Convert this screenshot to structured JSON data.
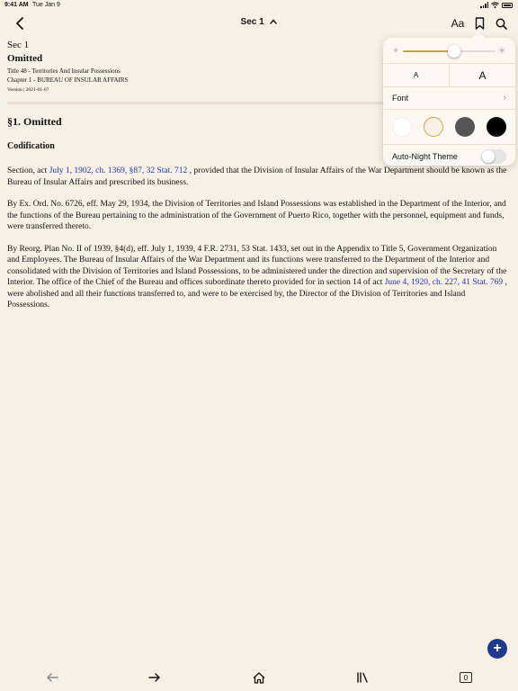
{
  "status": {
    "time": "9:41 AM",
    "date": "Tue Jan 9"
  },
  "nav": {
    "title": "Sec 1",
    "font_button_label": "Aa"
  },
  "doc": {
    "section_label": "Sec 1",
    "status_heading": "Omitted",
    "title_line": "Title 48 - Territories And Insular Possessions",
    "chapter_line": "Chapter 1 - BUREAU OF INSULAR AFFAIRS",
    "version_line": "Version | 2021-01-07",
    "heading": "§1. Omitted",
    "subheading": "Codification",
    "p1": {
      "before": "Section, act ",
      "link": "July 1, 1902, ch. 1369, §87, 32 Stat. 712",
      "after": " , provided that the Division of Insular Affairs of the War Department should be known as the Bureau of Insular Affairs and prescribed its business."
    },
    "p2": "By Ex. Ord. No. 6726, eff. May 29, 1934, the Division of Territories and Island Possessions was established in the Department of the Interior, and the functions of the Bureau pertaining to the administration of the Government of Puerto Rico, together with the personnel, equipment and funds, were transferred thereto.",
    "p3": {
      "before": "By Reorg. Plan No. II of 1939, §4(d), eff. July 1, 1939, 4 F.R. 2731, 53 Stat. 1433, set out in the Appendix to Title 5, Government Organization and Employees. The Bureau of Insular Affairs of the War Department and its functions were transferred to the Department of the Interior and consolidated with the Division of Territories and Island Possessions, to be administered under the direction and supervision of the Secretary of the Interior. The office of the Chief of the Bureau and offices subordinate thereto provided for in section 14 of act ",
      "link": "June 4, 1920, ch. 227, 41 Stat. 769",
      "after": " , were abolished and all their functions transferred to, and were to be exercised by, the Director of the Division of Territories and Island Possessions."
    }
  },
  "popover": {
    "brightness": 0.55,
    "size_small_label": "A",
    "size_large_label": "A",
    "font_label": "Font",
    "themes": [
      {
        "name": "white",
        "color": "#ffffff",
        "selected": false
      },
      {
        "name": "sepia",
        "color": "#f7f1e5",
        "selected": true
      },
      {
        "name": "gray",
        "color": "#555555",
        "selected": false
      },
      {
        "name": "black",
        "color": "#000000",
        "selected": false
      }
    ],
    "auto_night_label": "Auto-Night Theme",
    "auto_night_on": false
  },
  "bottom": {
    "tab_count": "0"
  },
  "colors": {
    "accent": "#1f3a8a",
    "link": "#2233aa",
    "slider": "#c9a446",
    "selected_ring": "#c9a446"
  }
}
